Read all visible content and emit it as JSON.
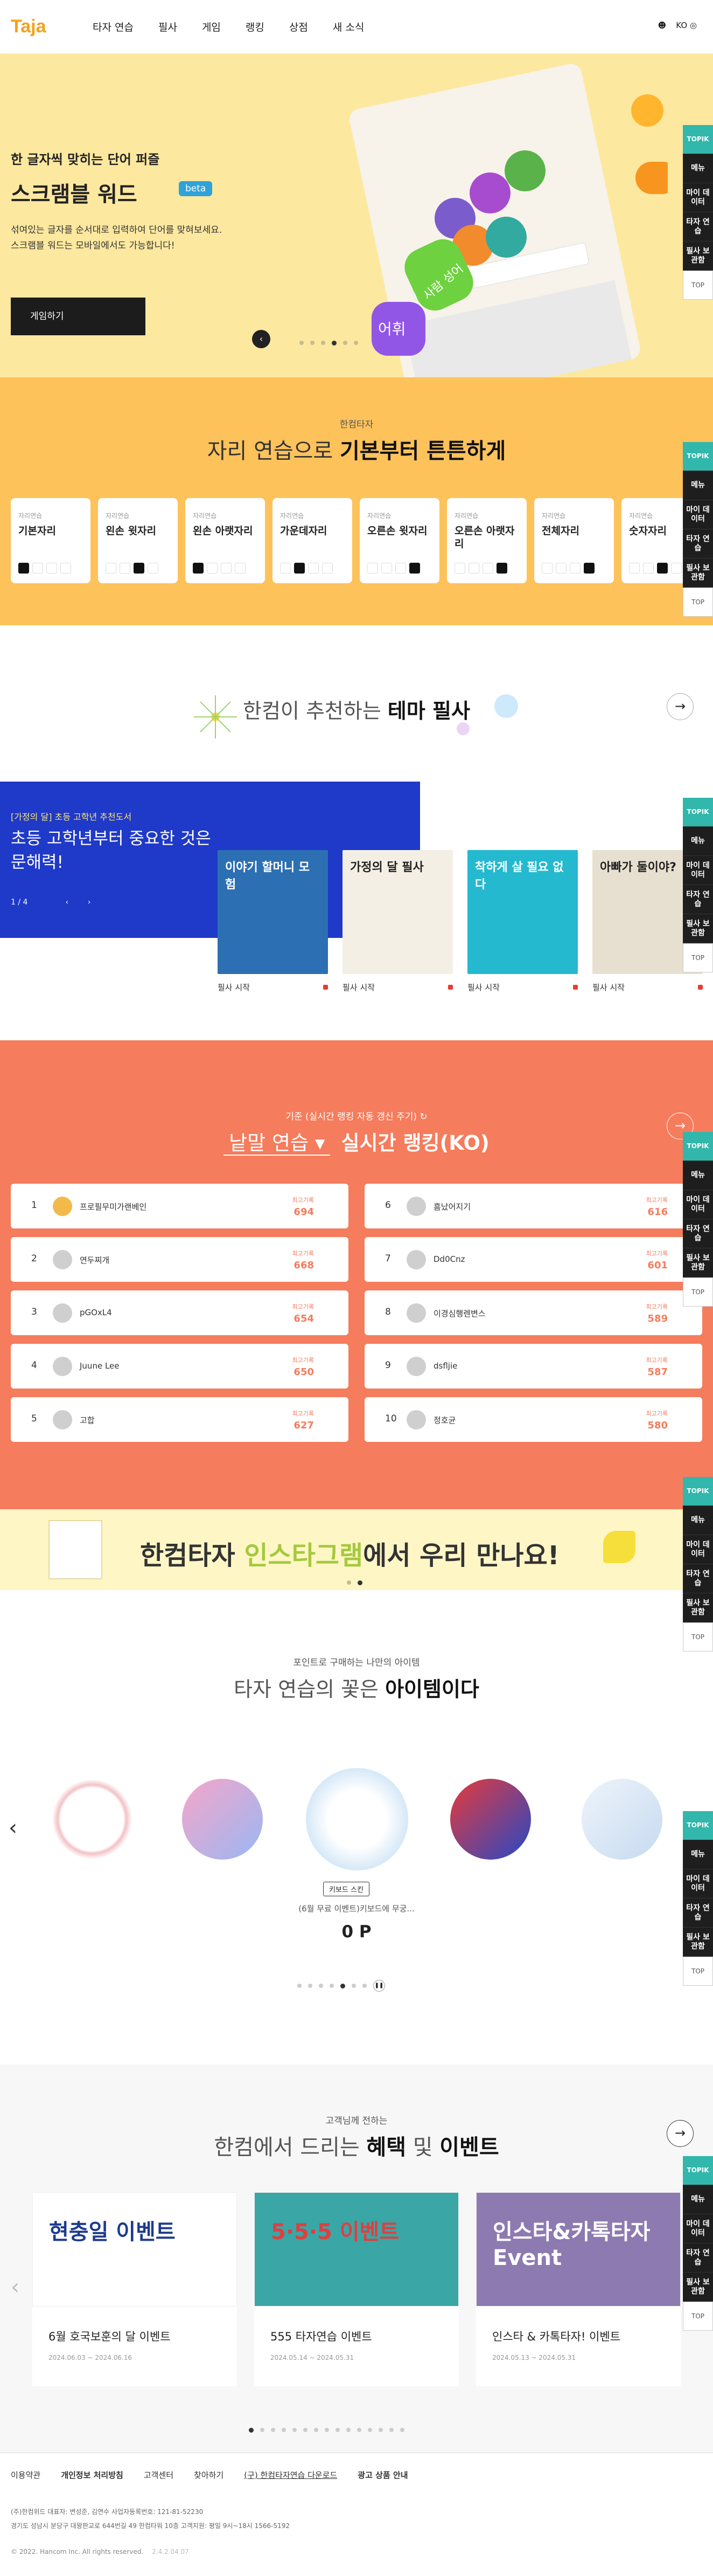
{
  "header": {
    "logo": "Taja",
    "nav": [
      "타자 연습",
      "필사",
      "게임",
      "랭킹",
      "상점",
      "새 소식"
    ],
    "lang": "KO"
  },
  "hero": {
    "eyebrow": "한 글자씩 맞히는 단어 퍼즐",
    "title": "스크램블 워드",
    "badge": "beta",
    "desc": "섞여있는 글자를 순서대로 입력하여 단어를 맞혀보세요.\n스크램블 워드는 모바일에서도 가능합니다!",
    "button": "게임하기",
    "slides": 6,
    "active_slide": 3,
    "bubble_left": "어휘",
    "bubble_right": "사람 성어"
  },
  "rail": {
    "items": [
      "TOPIK",
      "메뉴",
      "마이 데이터",
      "타자 연습",
      "필사 보관함"
    ],
    "top": "TOP"
  },
  "practice": {
    "sub": "한컴타자",
    "title_pre": "자리 연습으로 ",
    "title_bold": "기본부터 튼튼하게",
    "cards": [
      {
        "sub": "자리연습",
        "name": "기본자리",
        "key": 0
      },
      {
        "sub": "자리연습",
        "name": "왼손 윗자리",
        "key": 2
      },
      {
        "sub": "자리연습",
        "name": "왼손 아랫자리",
        "key": 0
      },
      {
        "sub": "자리연습",
        "name": "가운데자리",
        "key": 1
      },
      {
        "sub": "자리연습",
        "name": "오른손 윗자리",
        "key": 3
      },
      {
        "sub": "자리연습",
        "name": "오른손 아랫자리",
        "key": 3
      },
      {
        "sub": "자리연습",
        "name": "전체자리",
        "key": 3
      },
      {
        "sub": "자리연습",
        "name": "숫자자리",
        "key": 2
      }
    ]
  },
  "theme": {
    "title_pre": "한컴이 추천하는 ",
    "title_bold": "테마 필사"
  },
  "books": {
    "tag": "[가정의 달] 초등 고학년 추천도서",
    "title": "초등 고학년부터 중요한 것은 문해력!",
    "page": "1 / 4",
    "items": [
      {
        "cover_text": "이야기 할머니 모험",
        "color": "#2d6fb3",
        "label": "필사 시작"
      },
      {
        "cover_text": "가정의 달 필사",
        "color": "#f3efe5",
        "label": "필사 시작"
      },
      {
        "cover_text": "착하게 살 필요 없다",
        "color": "#25b9cf",
        "label": "필사 시작"
      },
      {
        "cover_text": "아빠가 둘이야?",
        "color": "#e7e0d0",
        "label": "필사 시작"
      }
    ]
  },
  "ranking": {
    "sub": "기준 (실시간 랭킹 자동 갱신 주기)",
    "mode": "낱말 연습 ▾",
    "title": "실시간 랭킹(KO)",
    "score_label": "최고기록",
    "rows": [
      {
        "rank": "1",
        "name": "프로필무미가랜베인",
        "score": "694"
      },
      {
        "rank": "2",
        "name": "연두찌개",
        "score": "668"
      },
      {
        "rank": "3",
        "name": "pGOxL4",
        "score": "654"
      },
      {
        "rank": "4",
        "name": "Juune Lee",
        "score": "650"
      },
      {
        "rank": "5",
        "name": "고합",
        "score": "627"
      },
      {
        "rank": "6",
        "name": "흠났어지기",
        "score": "616"
      },
      {
        "rank": "7",
        "name": "Dd0Cnz",
        "score": "601"
      },
      {
        "rank": "8",
        "name": "이경심행렌변스",
        "score": "589"
      },
      {
        "rank": "9",
        "name": "dsfljie",
        "score": "587"
      },
      {
        "rank": "10",
        "name": "정호균",
        "score": "580"
      }
    ]
  },
  "insta": {
    "pre": "한컴타자 ",
    "green": "인스타그램",
    "post": "에서 우리 만나요!"
  },
  "items": {
    "sub": "포인트로 구매하는 나만의 아이템",
    "title_pre": "타자 연습의 꽃은 ",
    "title_bold": "아이템이다",
    "label": "키보드 스킨",
    "name": "(6월 무료 이벤트)키보드에 무궁...",
    "points": "0 P"
  },
  "events": {
    "sub": "고객님께 전하는",
    "title_pre": "한컴에서 드리는 ",
    "title_b1": "혜택",
    "title_mid": " 및 ",
    "title_b2": "이벤트",
    "cards": [
      {
        "img": "현충일 이벤트",
        "title": "6월 호국보훈의 달 이벤트",
        "date": "2024.06.03 ~ 2024.06.16"
      },
      {
        "img": "5·5·5 이벤트",
        "title": "555 타자연습 이벤트",
        "date": "2024.05.14 ~ 2024.05.31"
      },
      {
        "img": "인스타&카톡타자 Event",
        "title": "인스타 & 카톡타자! 이벤트",
        "date": "2024.05.13 ~ 2024.05.31"
      }
    ]
  },
  "footer": {
    "links": [
      "이용약관",
      "개인정보 처리방침",
      "고객센터",
      "찾아하기",
      "(구) 한컴타자연습 다운로드",
      "광고 상품 안내"
    ],
    "info1": "(주)한컴위드 대표자: 변성준, 김연수 사업자등록번호: 121-81-52230",
    "info2": "경기도 성남시 분당구 대왕판교로 644번길 49 한컴타워 10층 고객지원: 평일 9시~18시 1566-5192",
    "copy": "© 2022. Hancom Inc. All rights reserved.",
    "ver": "2.4.2.04.07"
  }
}
